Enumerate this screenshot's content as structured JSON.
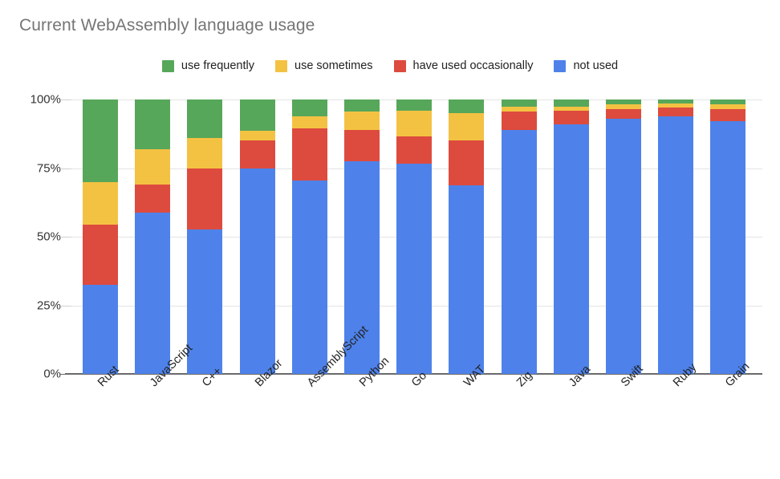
{
  "chart_data": {
    "type": "bar",
    "subtype": "stacked-percent",
    "title": "Current WebAssembly language usage",
    "xlabel": "",
    "ylabel": "",
    "ylim": [
      0,
      100
    ],
    "ytick_labels": [
      "0%",
      "25%",
      "50%",
      "75%",
      "100%"
    ],
    "ytick_values": [
      0,
      25,
      50,
      75,
      100
    ],
    "grid": true,
    "legend_position": "top-center",
    "categories": [
      "Rust",
      "JavaScript",
      "C++",
      "Blazor",
      "AssemblyScript",
      "Python",
      "Go",
      "WAT",
      "Zig",
      "Java",
      "Swift",
      "Ruby",
      "Grain"
    ],
    "series": [
      {
        "name": "not used",
        "color": "#4e82ea",
        "values": [
          32.5,
          58.8,
          52.5,
          75.0,
          70.5,
          77.5,
          76.5,
          68.8,
          89.0,
          90.8,
          93.0,
          94.0,
          92.0
        ]
      },
      {
        "name": "have used occasionally",
        "color": "#dd4b3e",
        "values": [
          22.0,
          10.2,
          22.5,
          10.0,
          19.0,
          11.5,
          10.0,
          16.2,
          6.5,
          5.2,
          3.5,
          3.0,
          4.5
        ]
      },
      {
        "name": "use sometimes",
        "color": "#f4c242",
        "values": [
          15.5,
          13.0,
          11.0,
          3.5,
          4.5,
          6.5,
          9.5,
          10.0,
          2.0,
          1.5,
          1.8,
          1.5,
          1.8
        ]
      },
      {
        "name": "use frequently",
        "color": "#57a75a",
        "values": [
          30.0,
          18.0,
          14.0,
          11.5,
          6.0,
          4.5,
          4.0,
          5.0,
          2.5,
          2.5,
          1.7,
          1.5,
          1.7
        ]
      }
    ]
  },
  "legend": {
    "items": [
      {
        "label": "use frequently",
        "color": "#57a75a"
      },
      {
        "label": "use sometimes",
        "color": "#f4c242"
      },
      {
        "label": "have used occasionally",
        "color": "#dd4b3e"
      },
      {
        "label": "not used",
        "color": "#4e82ea"
      }
    ]
  },
  "colors": {
    "title": "#757575",
    "axis": "#6a6a6a",
    "gridline": "#e4e4e4",
    "tick_text": "#333333",
    "background": "#ffffff"
  }
}
